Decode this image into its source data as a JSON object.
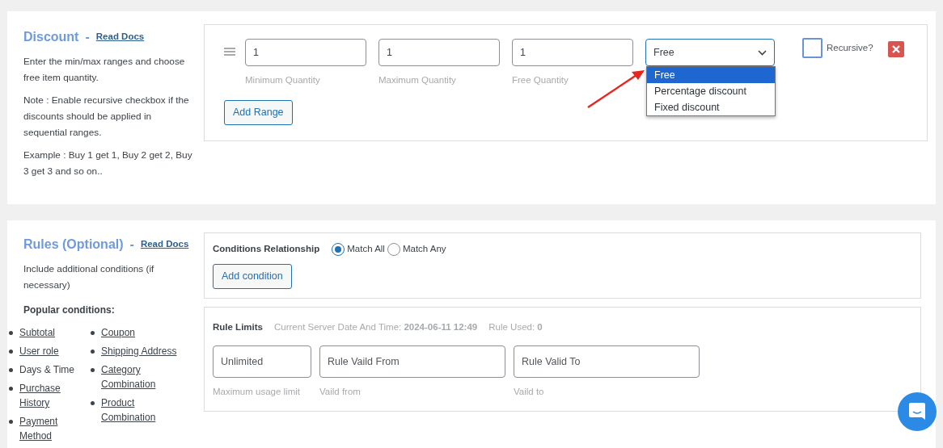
{
  "discount": {
    "title": "Discount",
    "separator": "-",
    "docs_link": "Read Docs",
    "description": [
      "Enter the min/max ranges and choose free item quantity.",
      "Note : Enable recursive checkbox if the discounts should be applied in sequential ranges.",
      "Example : Buy 1 get 1, Buy 2 get 2, Buy 3 get 3 and so on.."
    ],
    "field_labels": [
      "Minimum Quantity",
      "Maximum Quantity",
      "Free Quantity"
    ],
    "ranges": [
      {
        "min": "1",
        "max": "1",
        "free": "1",
        "type": {
          "value": "Free",
          "expanded": true,
          "options": [
            {
              "label": "Free",
              "selected": true
            },
            {
              "label": "Percentage discount",
              "selected": false
            },
            {
              "label": "Fixed discount",
              "selected": false
            }
          ]
        },
        "recursive": {
          "label": "Recursive?",
          "checked": false
        }
      }
    ],
    "add_button": "Add Range"
  },
  "rules": {
    "title": "Rules (Optional)",
    "separator": "-",
    "docs_link": "Read Docs",
    "description": "Include additional conditions (if necessary)",
    "popular_heading": "Popular conditions:",
    "popular_columns": [
      [
        {
          "label": "Subtotal",
          "kind": "link"
        },
        {
          "label": "User role",
          "kind": "link"
        },
        {
          "label": "Days & Time",
          "kind": "text"
        },
        {
          "label": "Purchase History",
          "kind": "link"
        },
        {
          "label": "Payment Method",
          "kind": "link"
        }
      ],
      [
        {
          "label": "Coupon",
          "kind": "link"
        },
        {
          "label": "Shipping Address",
          "kind": "link"
        },
        {
          "label": "Category Combination",
          "kind": "link"
        },
        {
          "label": "Product Combination",
          "kind": "link"
        }
      ]
    ],
    "relationship": {
      "label": "Conditions Relationship",
      "options": [
        {
          "label": "Match All",
          "selected": true
        },
        {
          "label": "Match Any",
          "selected": false
        }
      ]
    },
    "add_button": "Add condition",
    "limits": {
      "title": "Rule Limits",
      "server_time": "Current Server Date And Time: **2024-06-11 12:49**",
      "used": "Rule Used: **0**",
      "fields": [
        {
          "placeholder": "Unlimited",
          "caption": "Maximum usage limit"
        },
        {
          "placeholder": "Rule Vaild From",
          "caption": "Vaild from"
        },
        {
          "placeholder": "Rule Valid To",
          "caption": "Vaild to"
        }
      ]
    }
  }
}
